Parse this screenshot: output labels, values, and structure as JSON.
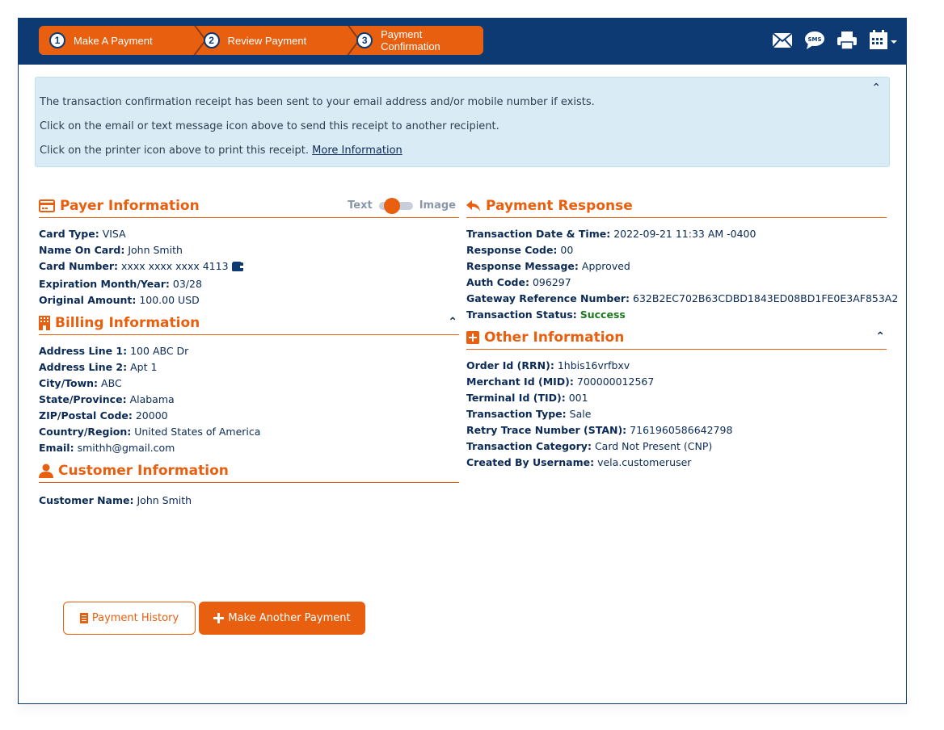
{
  "wizard": {
    "steps": [
      {
        "number": "1",
        "label": "Make A Payment"
      },
      {
        "number": "2",
        "label": "Review Payment"
      },
      {
        "number": "3",
        "label": "Payment Confirmation"
      }
    ],
    "active_step": 3
  },
  "toolbar": {
    "icons": [
      "email-icon",
      "sms-icon",
      "printer-icon",
      "calendar-icon"
    ],
    "sms_label": "SMS"
  },
  "alert": {
    "line1": "The transaction confirmation receipt has been sent to your email address and/or mobile number if exists.",
    "line2": "Click on the email or text message icon above to send this receipt to another recipient.",
    "line3": "Click on the printer icon above to print this receipt.",
    "link": "More Information"
  },
  "payer": {
    "title": "Payer Information",
    "toggle": {
      "left": "Text",
      "right": "Image",
      "selected": "Text"
    },
    "fields": [
      {
        "label": "Card Type:",
        "value": "VISA"
      },
      {
        "label": "Name On Card:",
        "value": "John Smith"
      },
      {
        "label": "Card Number:",
        "value": "xxxx xxxx xxxx 4113"
      },
      {
        "label": "Expiration Month/Year:",
        "value": "03/28"
      },
      {
        "label": "Original Amount:",
        "value": "100.00 USD"
      }
    ]
  },
  "billing": {
    "title": "Billing Information",
    "fields": [
      {
        "label": "Address Line 1:",
        "value": "100 ABC Dr"
      },
      {
        "label": "Address Line 2:",
        "value": "Apt 1"
      },
      {
        "label": "City/Town:",
        "value": "ABC"
      },
      {
        "label": "State/Province:",
        "value": "Alabama"
      },
      {
        "label": "ZIP/Postal Code:",
        "value": "20000"
      },
      {
        "label": "Country/Region:",
        "value": "United States of America"
      },
      {
        "label": "Email:",
        "value": "smithh@gmail.com"
      }
    ]
  },
  "customer": {
    "title": "Customer Information",
    "fields": [
      {
        "label": "Customer Name:",
        "value": "John Smith"
      }
    ]
  },
  "response": {
    "title": "Payment Response",
    "fields": [
      {
        "label": "Transaction Date & Time:",
        "value": "2022-09-21 11:33 AM -0400"
      },
      {
        "label": "Response Code:",
        "value": "00"
      },
      {
        "label": "Response Message:",
        "value": "Approved"
      },
      {
        "label": "Auth Code:",
        "value": "096297"
      },
      {
        "label": "Gateway Reference Number:",
        "value": "632B2EC702B63CDBD1843ED08BD1FE0E3AF853A2"
      },
      {
        "label": "Transaction Status:",
        "value": "Success"
      }
    ],
    "status_color": "#1f7a1f"
  },
  "other": {
    "title": "Other Information",
    "fields": [
      {
        "label": "Order Id (RRN):",
        "value": "1hbis16vrfbxv"
      },
      {
        "label": "Merchant Id (MID):",
        "value": "700000012567"
      },
      {
        "label": "Terminal Id (TID):",
        "value": "001"
      },
      {
        "label": "Transaction Type:",
        "value": "Sale"
      },
      {
        "label": "Retry Trace Number (STAN):",
        "value": "7161960586642798"
      },
      {
        "label": "Transaction Category:",
        "value": "Card Not Present (CNP)"
      },
      {
        "label": "Created By Username:",
        "value": "vela.customeruser"
      }
    ]
  },
  "actions": {
    "history": "Payment History",
    "another": "Make Another Payment"
  },
  "colors": {
    "brand_navy": "#0d3a72",
    "accent_orange": "#e8600f",
    "alert_bg": "#d9ecf5"
  }
}
